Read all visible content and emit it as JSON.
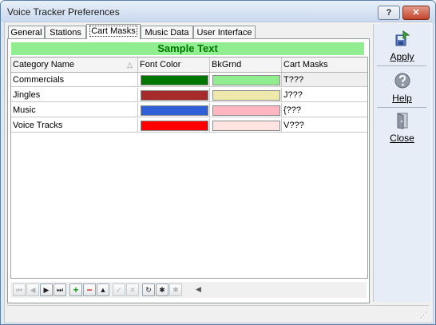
{
  "window": {
    "title": "Voice Tracker Preferences",
    "help_glyph": "?",
    "close_glyph": "✕"
  },
  "tabs": [
    {
      "label": "General"
    },
    {
      "label": "Stations"
    },
    {
      "label": "Cart Masks",
      "active": true
    },
    {
      "label": "Music Data"
    },
    {
      "label": "User Interface"
    }
  ],
  "sample": {
    "text": "Sample Text",
    "background": "#90ee90",
    "color": "#007700"
  },
  "grid": {
    "columns": [
      "Category Name",
      "Font Color",
      "BkGrnd",
      "Cart Masks"
    ],
    "sort_indicator": "△",
    "rows": [
      {
        "name": "Commercials",
        "font_color": "#007700",
        "bk_color": "#90ee90",
        "mask": "T???"
      },
      {
        "name": "Jingles",
        "font_color": "#a52a2a",
        "bk_color": "#eee8aa",
        "mask": "J???"
      },
      {
        "name": "Music",
        "font_color": "#3060d8",
        "bk_color": "#ffb6c1",
        "mask": "{???"
      },
      {
        "name": "Voice Tracks",
        "font_color": "#ff0000",
        "bk_color": "#ffe4e1",
        "mask": "V???"
      }
    ]
  },
  "navigator": {
    "buttons": [
      {
        "glyph": "⏮",
        "icon": "first-record-icon",
        "enabled": false
      },
      {
        "glyph": "◀",
        "icon": "prior-record-icon",
        "enabled": false
      },
      {
        "glyph": "▶",
        "icon": "next-record-icon",
        "enabled": true
      },
      {
        "glyph": "⏭",
        "icon": "last-record-icon",
        "enabled": true
      },
      {
        "glyph": "+",
        "icon": "insert-record-icon",
        "enabled": true
      },
      {
        "glyph": "−",
        "icon": "delete-record-icon",
        "enabled": true
      },
      {
        "glyph": "▲",
        "icon": "edit-record-icon",
        "enabled": true
      },
      {
        "glyph": "✓",
        "icon": "post-record-icon",
        "enabled": false
      },
      {
        "glyph": "✕",
        "icon": "cancel-edit-icon",
        "enabled": false
      },
      {
        "glyph": "↻",
        "icon": "refresh-icon",
        "enabled": true
      },
      {
        "glyph": "✱",
        "icon": "set-bookmark-icon",
        "enabled": true
      },
      {
        "glyph": "✱",
        "icon": "goto-bookmark-icon",
        "enabled": false
      }
    ],
    "scroll_glyph": "◀"
  },
  "actions": {
    "apply": "Apply",
    "help": "Help",
    "close": "Close"
  }
}
